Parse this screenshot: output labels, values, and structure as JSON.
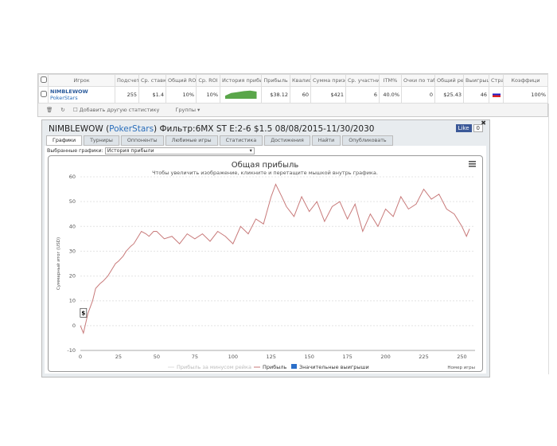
{
  "table": {
    "headers": [
      "",
      "Игрок",
      "Подсчет",
      "Ср. ставк",
      "Общий ROI",
      "Ср. ROI",
      "История прибы",
      "Прибыль",
      "Квалиф",
      "Сумма призов",
      "Ср. участник",
      "ITM%",
      "Очки по таб.",
      "Общий рей",
      "Выигрыш",
      "Стра",
      "Коэффици"
    ],
    "row": {
      "player": "NIMBLEWOW",
      "site": "PokerStars",
      "count": "255",
      "avg_stake": "$1.4",
      "total_roi": "10%",
      "avg_roi": "10%",
      "profit": "$38.12",
      "qual": "60",
      "prizes": "$421",
      "avg_entrants": "6",
      "itm": "40.0%",
      "points": "0",
      "rake": "$25.43",
      "wins": "46",
      "ratio": "100%"
    },
    "footer": {
      "add_stat": "Добавить другую статистику",
      "groups": "Группы ▾"
    }
  },
  "panel": {
    "player": "NIMBLEWOW",
    "site": "PokerStars",
    "filter": "Фильтр:6MX ST E:2-6 $1.5 08/08/2015-11/30/2030",
    "like": "Like",
    "like_count": "0",
    "tabs": [
      "Графики",
      "Турниры",
      "Оппоненты",
      "Любимые игры",
      "Статистика",
      "Достижения",
      "Найти",
      "Опубликовать"
    ],
    "selected_label": "Выбранные графики:",
    "selected_value": "История прибыли"
  },
  "chart_data": {
    "type": "line",
    "title": "Общая прибыль",
    "subtitle": "Чтобы увеличить изображение, кликните и перетащите мышкой внутрь графика.",
    "xlabel": "Номер игры",
    "ylabel": "Суммарный итог (USD)",
    "xlim": [
      0,
      255
    ],
    "ylim": [
      -10,
      60
    ],
    "xticks": [
      0,
      25,
      50,
      75,
      100,
      125,
      150,
      175,
      200,
      225,
      250
    ],
    "yticks": [
      -10,
      0,
      10,
      20,
      30,
      40,
      50,
      60
    ],
    "legend": [
      "Прибыль за минусом рейка",
      "Прибыль",
      "Значительные выигрыши"
    ],
    "marker": "$",
    "series": [
      {
        "name": "Прибыль",
        "color": "#c87a7a",
        "x": [
          0,
          2,
          5,
          8,
          10,
          13,
          15,
          18,
          20,
          23,
          25,
          28,
          30,
          33,
          35,
          38,
          40,
          43,
          45,
          48,
          50,
          55,
          60,
          65,
          70,
          75,
          80,
          85,
          90,
          95,
          100,
          105,
          110,
          115,
          120,
          125,
          128,
          132,
          135,
          140,
          145,
          150,
          155,
          160,
          165,
          170,
          175,
          180,
          185,
          190,
          195,
          200,
          205,
          210,
          215,
          220,
          225,
          230,
          235,
          240,
          245,
          250,
          253,
          255
        ],
        "y": [
          0,
          -3,
          5,
          10,
          15,
          17,
          18,
          20,
          22,
          25,
          26,
          28,
          30,
          32,
          33,
          36,
          38,
          37,
          36,
          38,
          38,
          35,
          36,
          33,
          37,
          35,
          37,
          34,
          38,
          36,
          33,
          40,
          37,
          43,
          41,
          52,
          57,
          52,
          48,
          44,
          52,
          46,
          50,
          42,
          48,
          50,
          43,
          49,
          38,
          45,
          40,
          47,
          44,
          52,
          47,
          49,
          55,
          51,
          53,
          47,
          45,
          40,
          36,
          39
        ]
      }
    ]
  }
}
